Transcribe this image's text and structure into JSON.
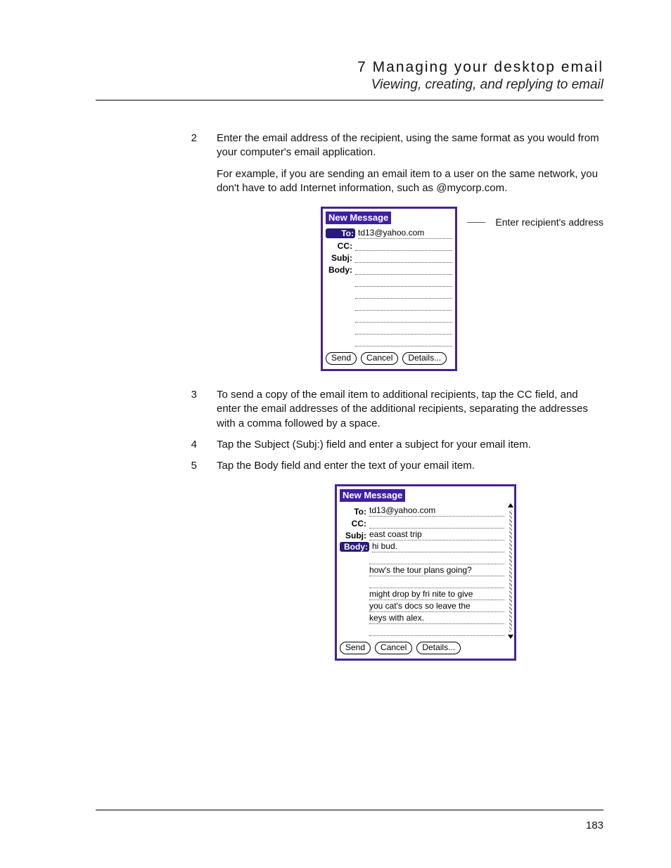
{
  "header": {
    "chapter": "7 Managing your desktop email",
    "section": "Viewing, creating, and replying to email"
  },
  "steps": [
    {
      "num": "2",
      "paras": [
        "Enter the email address of the recipient, using the same format as you would from your computer's email application.",
        "For example, if you are sending an email item to a user on the same network, you don't have to add Internet information, such as @mycorp.com."
      ]
    },
    {
      "num": "3",
      "paras": [
        "To send a copy of the email item to additional recipients, tap the CC field, and enter the email addresses of the additional recipients, separating the addresses with a comma followed by a space."
      ]
    },
    {
      "num": "4",
      "paras": [
        "Tap the Subject (Subj:) field and enter a subject for your email item."
      ]
    },
    {
      "num": "5",
      "paras": [
        "Tap the Body field and enter the text of your email item."
      ]
    }
  ],
  "callout1": "Enter recipient's address",
  "device1": {
    "title": "New Message",
    "to_label": "To:",
    "to_value": "td13@yahoo.com",
    "cc_label": "CC:",
    "cc_value": "",
    "subj_label": "Subj:",
    "subj_value": "",
    "body_label": "Body:",
    "body_lines": [
      "",
      "",
      "",
      "",
      "",
      "",
      ""
    ]
  },
  "device2": {
    "title": "New Message",
    "to_label": "To:",
    "to_value": "td13@yahoo.com",
    "cc_label": "CC:",
    "cc_value": "",
    "subj_label": "Subj:",
    "subj_value": "east coast trip",
    "body_label": "Body:",
    "body_lines": [
      "hi bud.",
      "",
      "how's the tour plans going?",
      "",
      "might drop by fri nite to give",
      "you cat's docs so leave the",
      "keys with alex."
    ]
  },
  "buttons": {
    "send": "Send",
    "cancel": "Cancel",
    "details": "Details..."
  },
  "page_number": "183"
}
